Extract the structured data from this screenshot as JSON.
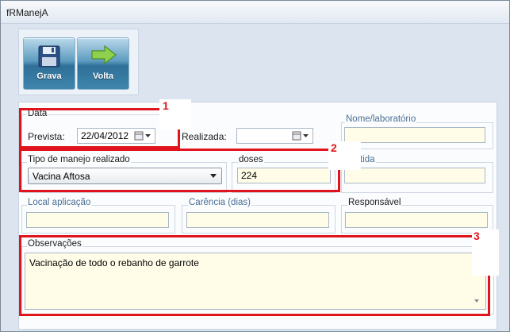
{
  "window": {
    "title": "fRManejA"
  },
  "toolbar": {
    "save_label": "Grava",
    "back_label": "Volta"
  },
  "data_group": {
    "title": "Data",
    "prevista_label": "Prevista:",
    "prevista_value": "22/04/2012",
    "realizada_label": "Realizada:",
    "realizada_value": ""
  },
  "nome_lab": {
    "label": "Nome/laboratório",
    "value": ""
  },
  "tipo_manejo": {
    "label": "Tipo de manejo realizado",
    "selected": "Vacina Aftosa"
  },
  "doses": {
    "label": "doses",
    "value": "224"
  },
  "partida": {
    "label": "tida",
    "value": ""
  },
  "local_aplicacao": {
    "label": "Local aplicação",
    "value": ""
  },
  "carencia": {
    "label": "Carência (dias)",
    "value": ""
  },
  "responsavel": {
    "label": "Responsável",
    "value": ""
  },
  "observacoes": {
    "label": "Observações",
    "value": "Vacinação de todo o rebanho de garrote"
  },
  "callouts": [
    "1",
    "2",
    "3"
  ],
  "colors": {
    "highlight": "#e0141c",
    "field_bg": "#fffde8",
    "label_blue": "#4a6f96"
  },
  "icons": {
    "save": "floppy-disk-icon",
    "back": "green-arrow-icon",
    "calendar": "calendar-icon"
  }
}
